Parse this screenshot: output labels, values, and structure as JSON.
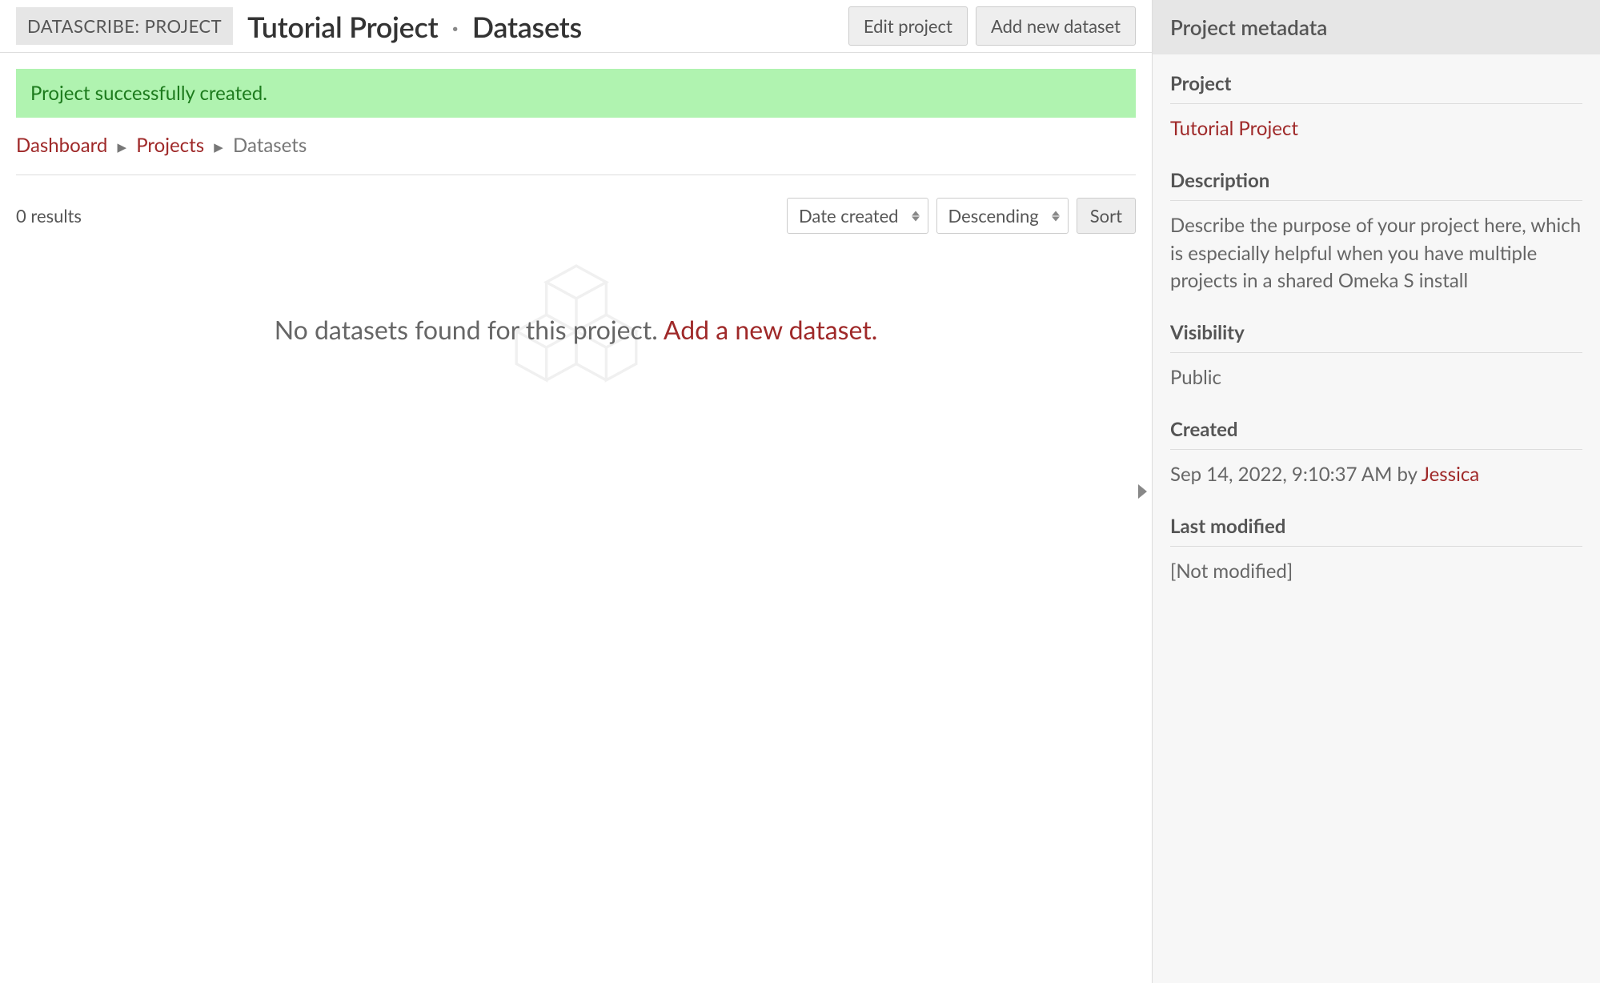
{
  "header": {
    "module_badge": "DATASCRIBE: PROJECT",
    "title_project": "Tutorial Project",
    "title_section": "Datasets",
    "edit_label": "Edit project",
    "add_label": "Add new dataset"
  },
  "alert": {
    "message": "Project successfully created."
  },
  "breadcrumbs": {
    "dashboard": "Dashboard",
    "projects": "Projects",
    "current": "Datasets"
  },
  "toolbar": {
    "results_count": "0 results",
    "sort_field": "Date created",
    "sort_direction": "Descending",
    "sort_button": "Sort"
  },
  "empty": {
    "message": "No datasets found for this project. ",
    "link": "Add a new dataset."
  },
  "sidebar": {
    "header": "Project metadata",
    "project": {
      "label": "Project",
      "value": "Tutorial Project"
    },
    "description": {
      "label": "Description",
      "value": "Describe the purpose of your project here, which is especially helpful when you have multiple projects in a shared Omeka S install"
    },
    "visibility": {
      "label": "Visibility",
      "value": "Public"
    },
    "created": {
      "label": "Created",
      "value_prefix": "Sep 14, 2022, 9:10:37 AM by ",
      "user": "Jessica"
    },
    "modified": {
      "label": "Last modified",
      "value": "[Not modified]"
    }
  }
}
